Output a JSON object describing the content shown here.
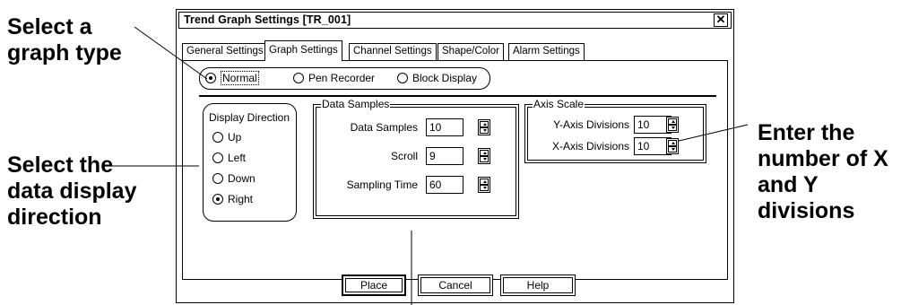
{
  "callouts": {
    "graph_type": [
      "Select a",
      "graph type"
    ],
    "direction": [
      "Select the",
      "data display",
      "direction"
    ],
    "divisions": [
      "Enter the",
      "number of X",
      "and Y",
      "divisions"
    ]
  },
  "dialog": {
    "title": "Trend Graph Settings [TR_001]",
    "close_glyph": "✕",
    "tabs": [
      "General Settings",
      "Graph Settings",
      "Channel Settings",
      "Shape/Color",
      "Alarm Settings"
    ],
    "active_tab": "Graph Settings",
    "graph_types": {
      "normal": "Normal",
      "pen_recorder": "Pen Recorder",
      "block_display": "Block Display",
      "selected": "Normal"
    },
    "display_direction": {
      "title": "Display Direction",
      "options": [
        "Up",
        "Left",
        "Down",
        "Right"
      ],
      "selected": "Right"
    },
    "data_samples": {
      "title": "Data Samples",
      "data_samples_label": "Data Samples",
      "data_samples_value": "10",
      "scroll_label": "Scroll",
      "scroll_value": "9",
      "sampling_time_label": "Sampling Time",
      "sampling_time_value": "60"
    },
    "axis_scale": {
      "title": "Axis Scale",
      "y_label": "Y-Axis Divisions",
      "y_value": "10",
      "x_label": "X-Axis Divisions",
      "x_value": "10"
    },
    "buttons": {
      "place": "Place",
      "cancel": "Cancel",
      "help": "Help"
    }
  },
  "icons": {
    "close": "close-icon",
    "spinner": "spinner-icon",
    "radio": "radio-icon"
  }
}
